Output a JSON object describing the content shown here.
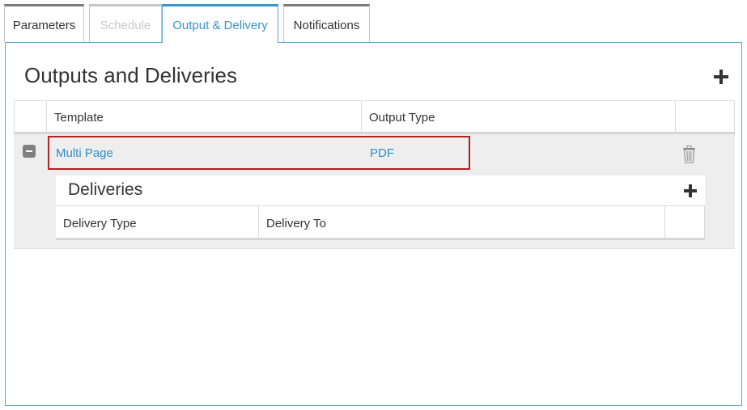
{
  "tabs": [
    {
      "label": "Parameters",
      "state": "normal"
    },
    {
      "label": "Schedule",
      "state": "disabled"
    },
    {
      "label": "Output & Delivery",
      "state": "active"
    },
    {
      "label": "Notifications",
      "state": "normal"
    }
  ],
  "section": {
    "title": "Outputs and Deliveries",
    "add_icon": "plus-icon"
  },
  "outputs_table": {
    "columns": [
      "Template",
      "Output Type"
    ],
    "rows": [
      {
        "template": "Multi Page",
        "output_type": "PDF",
        "expanded": true
      }
    ]
  },
  "deliveries": {
    "title": "Deliveries",
    "add_icon": "plus-icon",
    "columns": [
      "Delivery Type",
      "Delivery To"
    ]
  },
  "colors": {
    "accent": "#3a93c7",
    "link": "#2f8fc6",
    "selection_border": "#b22222",
    "row_bg": "#eeeeee"
  }
}
